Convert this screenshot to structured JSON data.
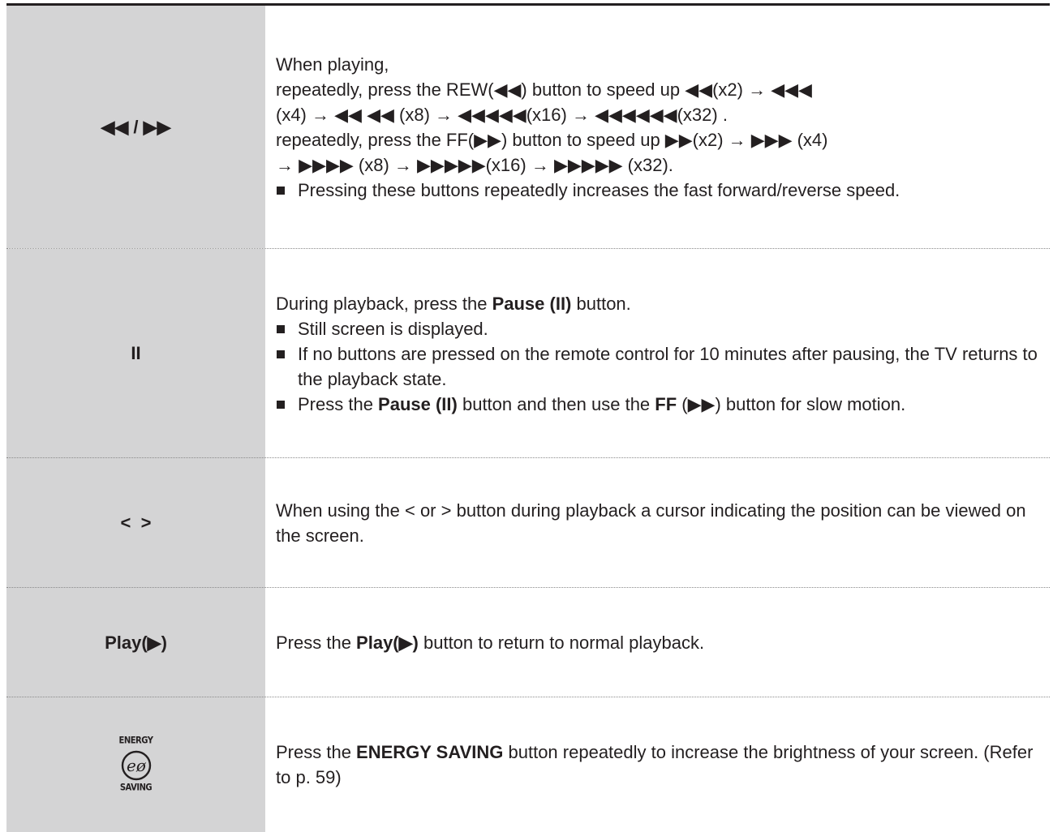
{
  "rows": [
    {
      "key": "◀◀ / ▶▶",
      "lines": [
        "When playing,",
        "repeatedly, press the REW(◀◀) button to speed up ◀◀(x2) → ◀◀◀",
        "(x4) → ◀◀ ◀◀ (x8) → ◀◀◀◀◀(x16) → ◀◀◀◀◀◀(x32) .",
        "repeatedly, press the FF(▶▶) button to speed up ▶▶(x2) → ▶▶▶ (x4)",
        "→ ▶▶▶▶ (x8) → ▶▶▶▶▶(x16) → ▶▶▶▶▶ (x32)."
      ],
      "bullets": [
        "Pressing these buttons repeatedly increases the fast forward/reverse speed."
      ]
    },
    {
      "key": "II",
      "intro_pre": "During playback, press the ",
      "intro_bold": "Pause (II)",
      "intro_post": " button.",
      "bullet1": "Still screen is displayed.",
      "bullet2": "If no buttons are pressed on the remote control for 10 minutes after pausing, the TV returns to the playback state.",
      "bullet3_pre": "Press the ",
      "bullet3_bold1": "Pause (II)",
      "bullet3_mid": " button and then use the ",
      "bullet3_bold2": "FF",
      "bullet3_post": " (▶▶) button for slow motion."
    },
    {
      "key": "<  >",
      "text": "When using the < or >  button during playback a cursor indicating the position can be viewed on the screen."
    },
    {
      "key": "Play(▶)",
      "pre": "Press the ",
      "bold": "Play(▶)",
      "post": " button to return to normal playback."
    },
    {
      "key_top": "ENERGY",
      "key_bottom": "SAVING",
      "pre": "Press the ",
      "bold": "ENERGY SAVING",
      "post": " button repeatedly to increase the brightness of your screen. (Refer to p. 59)"
    }
  ]
}
